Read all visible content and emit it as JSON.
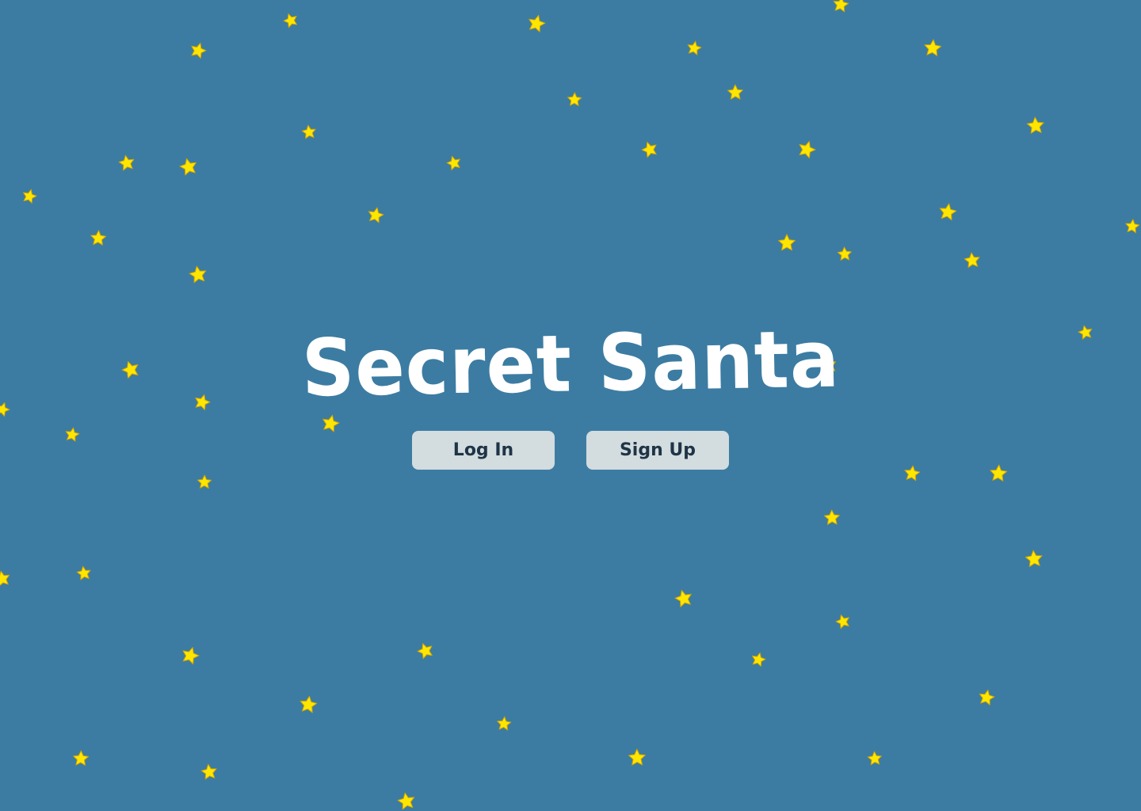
{
  "app": {
    "title": "Secret Santa"
  },
  "actions": {
    "login_label": "Log In",
    "signup_label": "Sign Up"
  },
  "colors": {
    "background": "#3c7ca2",
    "star_fill": "#ffe600",
    "star_stroke": "#d1a400",
    "title_text": "#ffffff",
    "button_bg": "#d3dcdf",
    "button_text": "#1f3446"
  },
  "decor": {
    "icon": "star-icon"
  }
}
